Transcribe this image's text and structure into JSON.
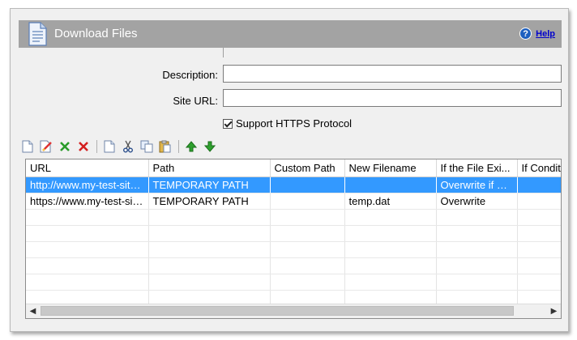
{
  "header": {
    "title": "Download Files",
    "help_label": "Help",
    "help_glyph": "?"
  },
  "form": {
    "description_label": "Description:",
    "description_value": "",
    "site_url_label": "Site URL:",
    "site_url_value": "",
    "https_label": "Support HTTPS Protocol",
    "https_checked": true
  },
  "toolbar": {
    "icons": [
      "new-icon",
      "edit-icon",
      "accept-icon",
      "delete-icon",
      "copy-page-icon",
      "cut-icon",
      "duplicate-icon",
      "paste-icon",
      "move-up-icon",
      "move-down-icon"
    ]
  },
  "grid": {
    "columns": [
      "URL",
      "Path",
      "Custom Path",
      "New Filename",
      "If the File Exi...",
      "If Condit"
    ],
    "rows": [
      [
        "http://www.my-test-site....",
        "TEMPORARY PATH",
        "",
        "",
        "Overwrite if di...",
        ""
      ],
      [
        "https://www.my-test-sit...",
        "TEMPORARY PATH",
        "",
        "temp.dat",
        "Overwrite",
        ""
      ]
    ],
    "selected_row": 0
  },
  "colors": {
    "header_bg": "#a3a3a3",
    "selection": "#3399ff",
    "frame_bg": "#f0f0f0"
  }
}
